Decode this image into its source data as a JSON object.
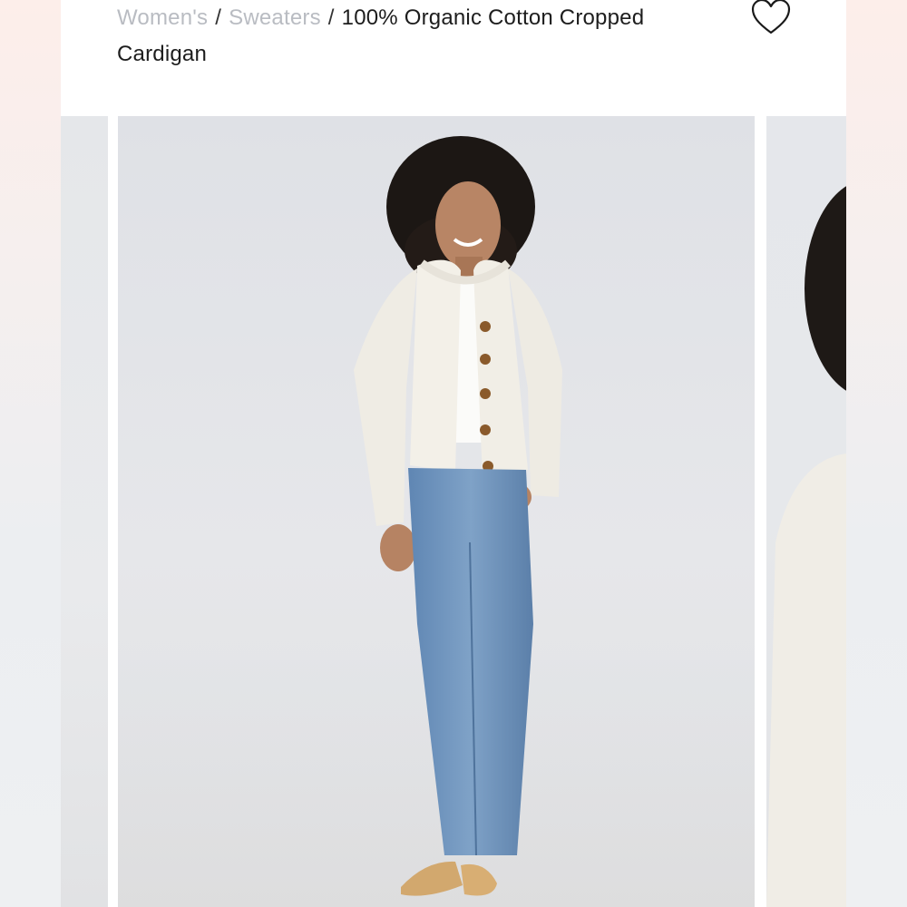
{
  "breadcrumb": {
    "items": [
      {
        "label": "Women's"
      },
      {
        "label": "Sweaters"
      }
    ],
    "separator": "/",
    "current": "100% Organic Cotton Cropped Cardigan"
  },
  "wishlist": {
    "icon": "heart-outline-icon"
  },
  "carousel": {
    "slides": [
      {
        "name": "previous-product-image"
      },
      {
        "name": "main-product-image",
        "subject": "model wearing white cropped cardigan with brown buttons, light blue jeans, tan woven flats"
      },
      {
        "name": "next-product-image"
      }
    ]
  },
  "colors": {
    "link_gray": "#b9bcc2",
    "text": "#1d1d1d",
    "cardigan": "#f3f0e8",
    "denim": "#6f93bb",
    "button": "#8a5a2b",
    "shoe": "#d2a86e"
  }
}
